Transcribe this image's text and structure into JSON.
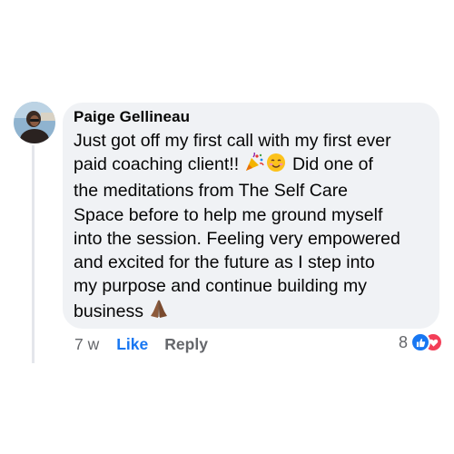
{
  "comment": {
    "author": "Paige Gellineau",
    "text_lines": [
      "Just got off my first call with my first ever",
      "paid coaching client!!",
      "Did one of",
      "the meditations from The Self Care",
      "Space before to help me ground myself",
      "into the session. Feeling very empowered",
      "and excited for the future as I step into",
      "my purpose and continue building my",
      "business"
    ],
    "emojis": [
      "party-popper-icon",
      "smiling-face-icon",
      "folded-hands-icon"
    ],
    "timestamp": "7 w",
    "like_label": "Like",
    "reply_label": "Reply",
    "reaction_count": "8",
    "reactions": [
      "like",
      "love"
    ]
  },
  "colors": {
    "bubble": "#f0f2f5",
    "like_blue": "#1877f2",
    "love_red": "#f33e58",
    "secondary_text": "#65676b"
  }
}
